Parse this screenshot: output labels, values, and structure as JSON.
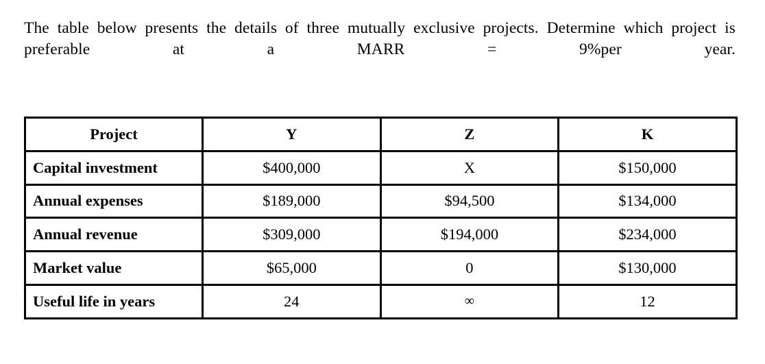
{
  "question": {
    "text": "The table below presents the details of three mutually exclusive projects. Determine which project is preferable at a MARR = 9%per year."
  },
  "table": {
    "headers": [
      "Project",
      "Y",
      "Z",
      "K"
    ],
    "rows": [
      {
        "label": "Capital investment",
        "values": [
          "$400,000",
          "X",
          "$150,000"
        ]
      },
      {
        "label": "Annual expenses",
        "values": [
          "$189,000",
          "$94,500",
          "$134,000"
        ]
      },
      {
        "label": "Annual revenue",
        "values": [
          "$309,000",
          "$194,000",
          "$234,000"
        ]
      },
      {
        "label": "Market value",
        "values": [
          "$65,000",
          "0",
          "$130,000"
        ]
      },
      {
        "label": "Useful life in years",
        "values": [
          "24",
          "∞",
          "12"
        ]
      }
    ]
  },
  "colors": {
    "background": "#ffffff",
    "text": "#000000",
    "border": "#000000"
  }
}
